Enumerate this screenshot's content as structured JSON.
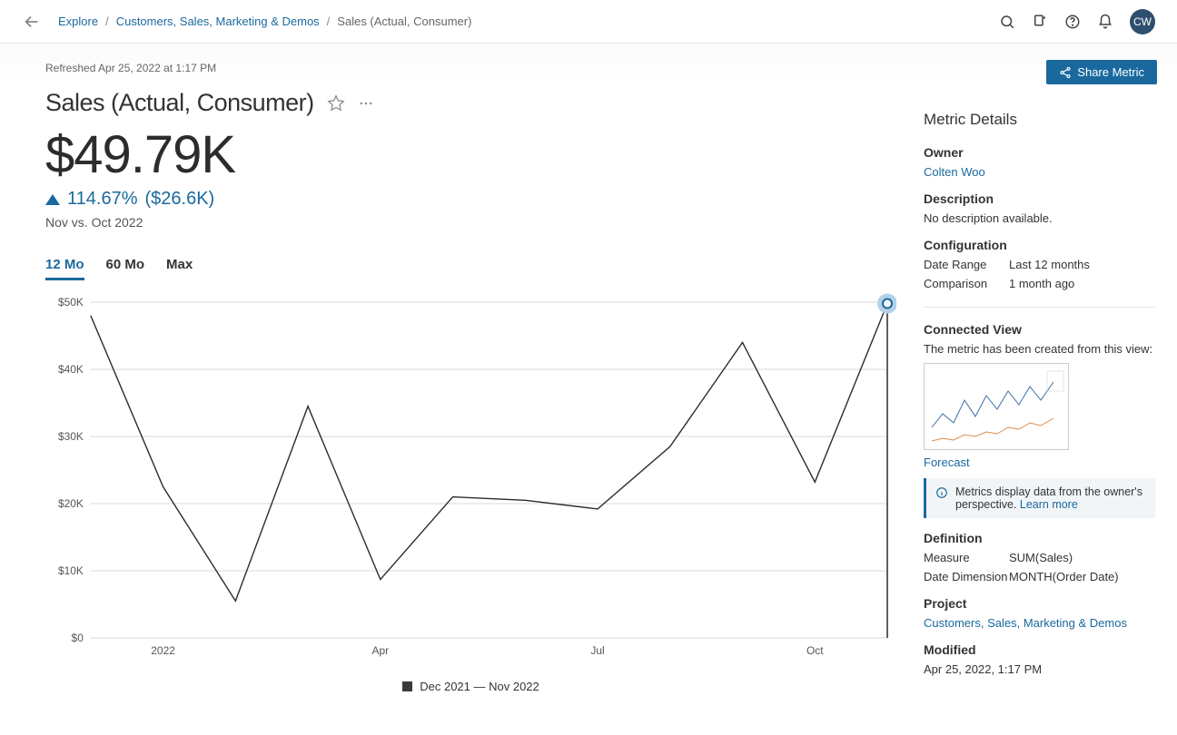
{
  "user": {
    "initials": "CW"
  },
  "breadcrumb": {
    "explore": "Explore",
    "project": "Customers, Sales, Marketing & Demos",
    "current": "Sales (Actual, Consumer)"
  },
  "share_btn": "Share Metric",
  "refreshed": "Refreshed Apr 25, 2022 at 1:17 PM",
  "title": "Sales (Actual, Consumer)",
  "value": "$49.79K",
  "change_pct": "114.67%",
  "change_abs": "($26.6K)",
  "compare_label": "Nov vs. Oct 2022",
  "range_tabs": {
    "t12": "12 Mo",
    "t60": "60 Mo",
    "tmax": "Max",
    "active": "t12"
  },
  "legend": "Dec 2021 — Nov 2022",
  "sidebar": {
    "heading": "Metric Details",
    "owner_h": "Owner",
    "owner": "Colten Woo",
    "desc_h": "Description",
    "desc": "No description available.",
    "config_h": "Configuration",
    "date_range_k": "Date Range",
    "date_range_v": "Last 12 months",
    "comparison_k": "Comparison",
    "comparison_v": "1 month ago",
    "connected_h": "Connected View",
    "connected_text": "The metric has been created from this view:",
    "forecast": "Forecast",
    "info_text": "Metrics display data from the owner's perspective. ",
    "info_link": "Learn more",
    "def_h": "Definition",
    "measure_k": "Measure",
    "measure_v": "SUM(Sales)",
    "datedim_k": "Date Dimension",
    "datedim_v": "MONTH(Order Date)",
    "project_h": "Project",
    "project": "Customers, Sales, Marketing & Demos",
    "modified_h": "Modified",
    "modified": "Apr 25, 2022, 1:17 PM"
  },
  "chart_data": {
    "type": "line",
    "categories": [
      "Dec 2021",
      "Jan 2022",
      "Feb 2022",
      "Mar 2022",
      "Apr 2022",
      "May 2022",
      "Jun 2022",
      "Jul 2022",
      "Aug 2022",
      "Sep 2022",
      "Oct 2022",
      "Nov 2022"
    ],
    "values": [
      48000,
      22500,
      5500,
      34500,
      8700,
      21000,
      20500,
      19200,
      28500,
      44000,
      23200,
      49790
    ],
    "ylabel": "",
    "xlabel": "",
    "ylim": [
      0,
      50000
    ],
    "yticks": [
      "$0",
      "$10K",
      "$20K",
      "$30K",
      "$40K",
      "$50K"
    ],
    "xticks_shown": {
      "Jan 2022": "2022",
      "Apr 2022": "Apr",
      "Jul 2022": "Jul",
      "Oct 2022": "Oct"
    }
  }
}
